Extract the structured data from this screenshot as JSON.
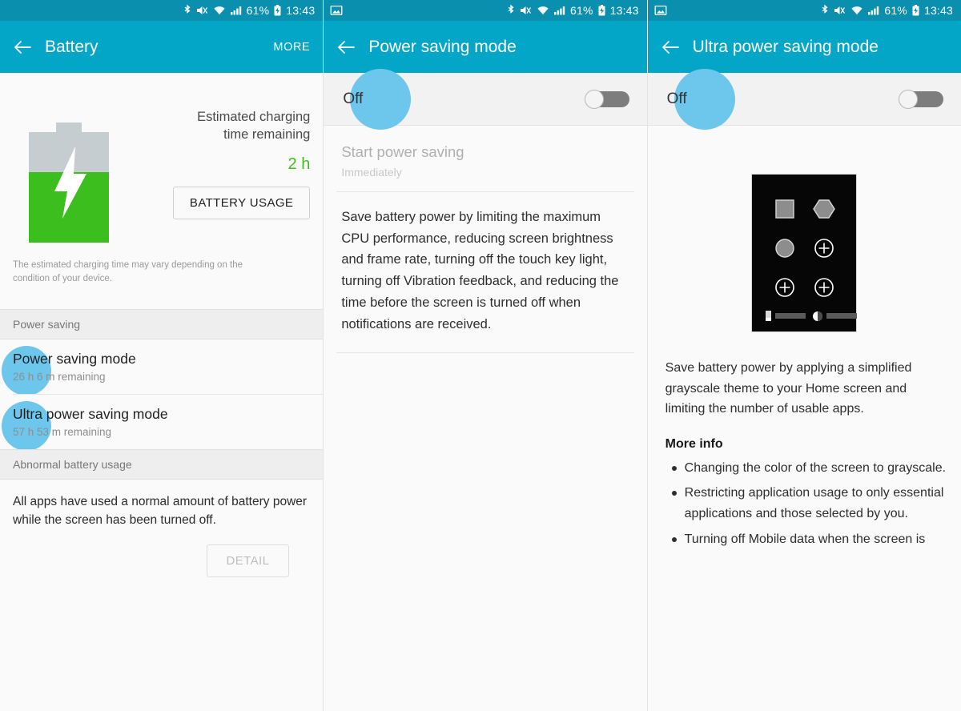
{
  "statusbar": {
    "battery_percent": "61%",
    "time": "13:43",
    "icons": [
      "screenshot-icon",
      "bluetooth-icon",
      "mute-icon",
      "wifi-icon",
      "signal-icon",
      "battery-charging-icon"
    ]
  },
  "colors": {
    "appbar": "#03a6c7",
    "statusbar": "#0b8fae",
    "ripple": "#6dc6ec",
    "battery_green": "#3cbf1e",
    "page_bg": "#fafafa",
    "section_header_bg": "#eeeeee",
    "toggle_track": "#7d7d7d"
  },
  "panel1": {
    "title": "Battery",
    "more_label": "MORE",
    "back_icon": "back-arrow-icon",
    "battery": {
      "icon": "battery-charging-icon",
      "estimated_label": "Estimated charging\ntime remaining",
      "estimated_label_line1": "Estimated charging",
      "estimated_label_line2": "time remaining",
      "estimated_value": "2 h",
      "usage_button": "BATTERY USAGE",
      "note": "The estimated charging time may vary depending on the condition of your device."
    },
    "power_saving_header": "Power saving",
    "items": [
      {
        "title": "Power saving mode",
        "subtitle": "26 h 6 m remaining"
      },
      {
        "title": "Ultra power saving mode",
        "subtitle": "57 h 53 m remaining"
      }
    ],
    "abnormal_header": "Abnormal battery usage",
    "abnormal_text": "All apps have used a normal amount of battery power while the screen has been turned off.",
    "detail_button": "DETAIL"
  },
  "panel2": {
    "title": "Power saving mode",
    "back_icon": "back-arrow-icon",
    "toggle_label": "Off",
    "toggle_state": "off",
    "start_title": "Start power saving",
    "start_subtitle": "Immediately",
    "description": "Save battery power by limiting the maximum CPU performance, reducing screen brightness and frame rate, turning off the touch key light, turning off Vibration feedback, and reducing the time before the screen is turned off when notifications are received."
  },
  "panel3": {
    "title": "Ultra power saving mode",
    "back_icon": "back-arrow-icon",
    "toggle_label": "Off",
    "toggle_state": "off",
    "mockup_icon": "grayscale-home-screen-mockup",
    "description": "Save battery power by applying a simplified grayscale theme to your Home screen and limiting the number of usable apps.",
    "more_info_heading": "More info",
    "bullets": [
      "Changing the color of the screen to grayscale.",
      "Restricting application usage to only essential applications and those selected by you.",
      "Turning off Mobile data when the screen is"
    ]
  }
}
